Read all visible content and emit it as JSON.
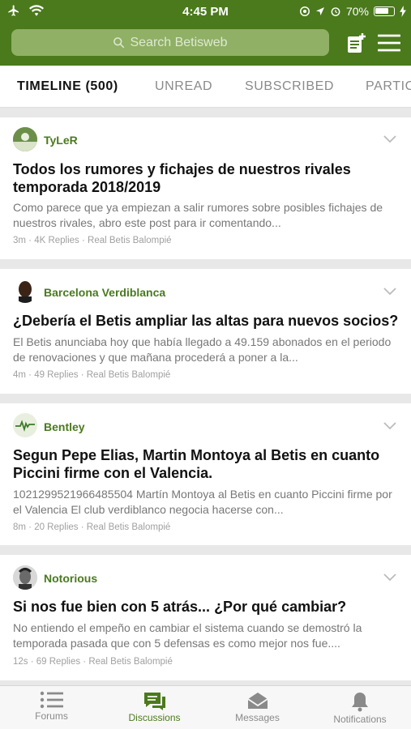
{
  "status": {
    "time": "4:45 PM",
    "battery": "70%"
  },
  "search": {
    "placeholder": "Search Betisweb"
  },
  "tabs": [
    {
      "label": "TIMELINE (500)"
    },
    {
      "label": "UNREAD"
    },
    {
      "label": "SUBSCRIBED"
    },
    {
      "label": "PARTIC"
    }
  ],
  "posts": [
    {
      "author": "TyLeR",
      "title": "Todos los rumores y fichajes de nuestros rivales temporada 2018/2019",
      "excerpt": "Como parece que ya empiezan a salir rumores sobre posibles fichajes de nuestros rivales, abro este post para ir comentando...",
      "meta": "3m · 4K Replies · Real Betis Balompié"
    },
    {
      "author": "Barcelona Verdiblanca",
      "title": "¿Debería el Betis ampliar las altas para nuevos socios?",
      "excerpt": "El Betis anunciaba hoy que había llegado a 49.159 abonados en el periodo de renovaciones y que mañana procederá a poner a la...",
      "meta": "4m · 49 Replies · Real Betis Balompié"
    },
    {
      "author": "Bentley",
      "title": "Segun Pepe Elias, Martin Montoya al Betis en cuanto Piccini firme con el Valencia.",
      "excerpt": "1021299521966485504 Martín Montoya al Betis en cuanto Piccini firme por el Valencia  El club verdiblanco negocia hacerse con...",
      "meta": "8m · 20 Replies · Real Betis Balompié"
    },
    {
      "author": "Notorious",
      "title": "Si nos fue bien con 5 atrás... ¿Por qué cambiar?",
      "excerpt": "No entiendo el empeño en cambiar el sistema cuando se demostró la temporada pasada que con 5 defensas es como mejor nos fue....",
      "meta": "12s · 69 Replies · Real Betis Balompié"
    }
  ],
  "bottom_nav": [
    {
      "label": "Forums",
      "icon": "list-icon"
    },
    {
      "label": "Discussions",
      "icon": "chat-icon",
      "active": true
    },
    {
      "label": "Messages",
      "icon": "envelope-icon"
    },
    {
      "label": "Notifications",
      "icon": "bell-icon"
    }
  ],
  "colors": {
    "brand": "#4a7a1c",
    "search_bg": "#8fb065"
  }
}
